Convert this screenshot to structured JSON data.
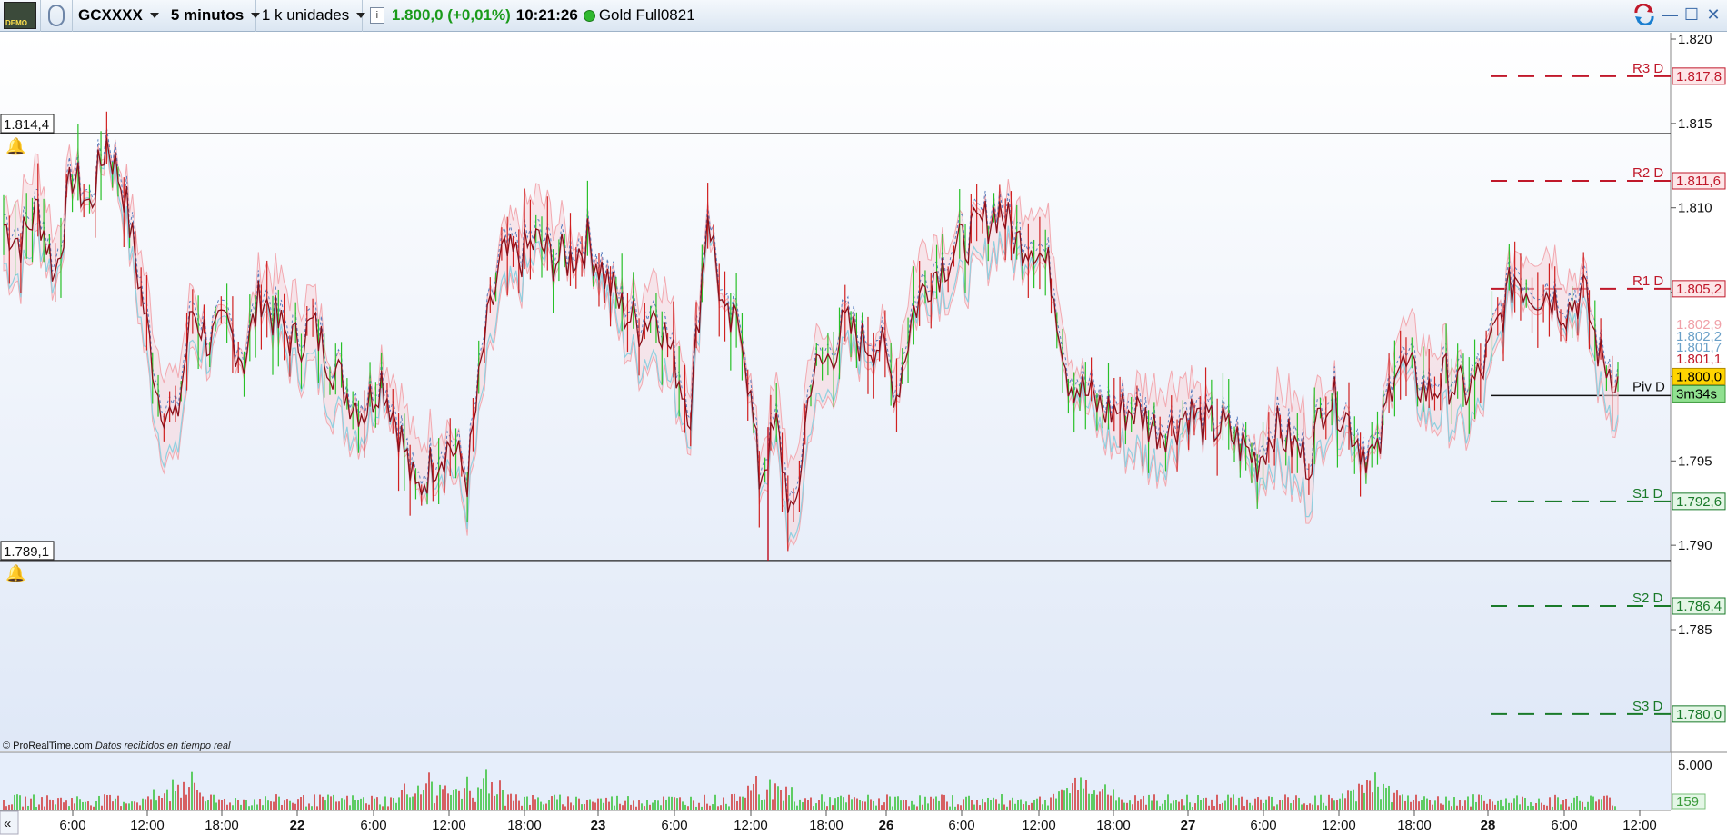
{
  "toolbar": {
    "demo_logo": "DEMO",
    "link_icon": "chain-link-icon",
    "instrument": "GCXXXX",
    "timeframe": "5 minutos",
    "units": "1 k unidades",
    "price": "1.800,0 (+0,01%)",
    "time": "10:21:26",
    "contract": "Gold Full0821"
  },
  "chart_data": {
    "type": "line",
    "title": "Gold Full0821",
    "y_ticks": [
      "1.820",
      "1.815",
      "1.810",
      "1.805",
      "1.800",
      "1.795",
      "1.790",
      "1.785"
    ],
    "y_tick_values": [
      1820,
      1815,
      1810,
      1805,
      1800,
      1795,
      1790,
      1785
    ],
    "ylim": [
      1782,
      1822
    ],
    "x_ticks": [
      "6:00",
      "12:00",
      "18:00",
      "22",
      "6:00",
      "12:00",
      "18:00",
      "23",
      "6:00",
      "12:00",
      "18:00",
      "26",
      "6:00",
      "12:00",
      "18:00",
      "27",
      "6:00",
      "12:00",
      "18:00",
      "28",
      "6:00",
      "12:00"
    ],
    "bold_x_ticks": [
      "22",
      "23",
      "26",
      "27",
      "28"
    ],
    "high_marker": "1.814,4",
    "low_marker": "1.789,1",
    "pivot_levels": [
      {
        "label": "R3 D",
        "value": 1817.8,
        "text": "1.817,8",
        "kind": "resistance"
      },
      {
        "label": "R2 D",
        "value": 1811.6,
        "text": "1.811,6",
        "kind": "resistance"
      },
      {
        "label": "R1 D",
        "value": 1805.2,
        "text": "1.805,2",
        "kind": "resistance"
      },
      {
        "label": "Piv D",
        "value": 1800.0,
        "text": "1.800,0",
        "kind": "pivot"
      },
      {
        "label": "S1 D",
        "value": 1792.6,
        "text": "1.792,6",
        "kind": "support"
      },
      {
        "label": "S2 D",
        "value": 1786.4,
        "text": "1.786,4",
        "kind": "support"
      },
      {
        "label": "S3 D",
        "value": 1780.0,
        "text": "1.780,0",
        "kind": "support"
      }
    ],
    "indicator_labels": [
      {
        "text": "1.802,9",
        "color": "#f0a0a8"
      },
      {
        "text": "1.802,2",
        "color": "#6aa0c8"
      },
      {
        "text": "1.801,7",
        "color": "#6aa0c8"
      },
      {
        "text": "1.801,1",
        "color": "#c0182a"
      }
    ],
    "current_price": "1.800,0",
    "countdown": "3m34s",
    "price_series": [
      1809,
      1808,
      1810,
      1806,
      1812,
      1810,
      1814,
      1811,
      1805,
      1799,
      1797,
      1804,
      1802,
      1803,
      1801,
      1805,
      1803,
      1802,
      1803,
      1801,
      1799,
      1798,
      1800,
      1797,
      1793,
      1795,
      1796,
      1794,
      1802,
      1807,
      1807,
      1808,
      1807,
      1807,
      1808,
      1806,
      1804,
      1803,
      1804,
      1801,
      1798,
      1810,
      1803,
      1803,
      1794,
      1797,
      1791,
      1800,
      1801,
      1803,
      1802,
      1802,
      1799,
      1804,
      1806,
      1807,
      1808,
      1809,
      1810,
      1808,
      1808,
      1806,
      1800,
      1799,
      1798,
      1798,
      1798,
      1797,
      1797,
      1798,
      1797,
      1797,
      1796,
      1795,
      1797,
      1796,
      1795,
      1799,
      1798,
      1796,
      1795,
      1801,
      1800,
      1799,
      1800,
      1799,
      1800,
      1803,
      1806,
      1805,
      1805,
      1804,
      1805,
      1801,
      1800
    ],
    "volume": {
      "ylim": [
        0,
        5000
      ],
      "tick": "5.000",
      "last": "159"
    }
  },
  "credit": {
    "site": "© ProRealTime.com",
    "note": "Datos recibidos en tiempo real"
  },
  "window": {
    "icons": [
      "refresh-arrows-icon",
      "minimize-icon",
      "maximize-icon",
      "close-icon"
    ]
  }
}
